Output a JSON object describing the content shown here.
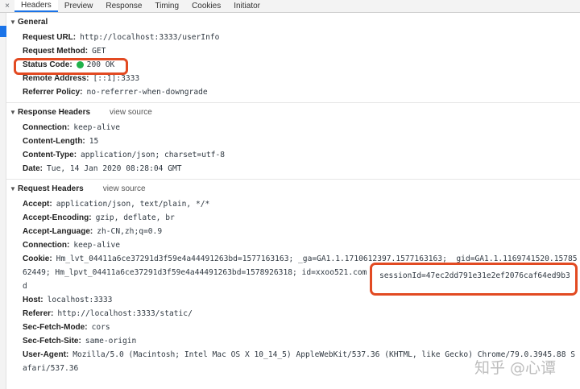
{
  "tabs": {
    "close_glyph": "×",
    "items": [
      {
        "label": "Headers",
        "active": true
      },
      {
        "label": "Preview"
      },
      {
        "label": "Response"
      },
      {
        "label": "Timing"
      },
      {
        "label": "Cookies"
      },
      {
        "label": "Initiator"
      }
    ]
  },
  "general": {
    "title": "General",
    "request_url": {
      "key": "Request URL:",
      "value": "http://localhost:3333/userInfo"
    },
    "request_method": {
      "key": "Request Method:",
      "value": "GET"
    },
    "status_code": {
      "key": "Status Code:",
      "value": "200 OK",
      "status_color": "#21b14b"
    },
    "remote_address": {
      "key": "Remote Address:",
      "value": "[::1]:3333"
    },
    "referrer_policy": {
      "key": "Referrer Policy:",
      "value": "no-referrer-when-downgrade"
    }
  },
  "response_headers": {
    "title": "Response Headers",
    "view_source": "view source",
    "rows": [
      {
        "key": "Connection:",
        "value": "keep-alive"
      },
      {
        "key": "Content-Length:",
        "value": "15"
      },
      {
        "key": "Content-Type:",
        "value": "application/json; charset=utf-8"
      },
      {
        "key": "Date:",
        "value": "Tue, 14 Jan 2020 08:28:04 GMT"
      }
    ]
  },
  "request_headers": {
    "title": "Request Headers",
    "view_source": "view source",
    "accept": {
      "key": "Accept:",
      "value": "application/json, text/plain, */*"
    },
    "accept_encoding": {
      "key": "Accept-Encoding:",
      "value": "gzip, deflate, br"
    },
    "accept_language": {
      "key": "Accept-Language:",
      "value": "zh-CN,zh;q=0.9"
    },
    "connection": {
      "key": "Connection:",
      "value": "keep-alive"
    },
    "cookie": {
      "key": "Cookie:",
      "line1": "Hm_lvt_04411a6ce37291d3f59e4a44491263bd=1577163163; _ga=GA1.1.1710612397.1577163163; _gid=GA1.1.1169741520.15785",
      "line2": "62449; Hm_lpvt_04411a6ce37291d3f59e4a44491263bd=1578926318; id=xxoo521.com",
      "line3": "d",
      "session": "sessionId=47ec2dd791e31e2ef2076caf64ed9b3"
    },
    "host": {
      "key": "Host:",
      "value": "localhost:3333"
    },
    "referer": {
      "key": "Referer:",
      "value": "http://localhost:3333/static/"
    },
    "sec_fetch_mode": {
      "key": "Sec-Fetch-Mode:",
      "value": "cors"
    },
    "sec_fetch_site": {
      "key": "Sec-Fetch-Site:",
      "value": "same-origin"
    },
    "user_agent": {
      "key": "User-Agent:",
      "line1": "Mozilla/5.0 (Macintosh; Intel Mac OS X 10_14_5) AppleWebKit/537.36 (KHTML, like Gecko) Chrome/79.0.3945.88 S",
      "line2": "afari/537.36"
    }
  },
  "watermark": "知乎 @心谭",
  "colors": {
    "accent": "#1a73e8",
    "highlight": "#e24a22"
  }
}
